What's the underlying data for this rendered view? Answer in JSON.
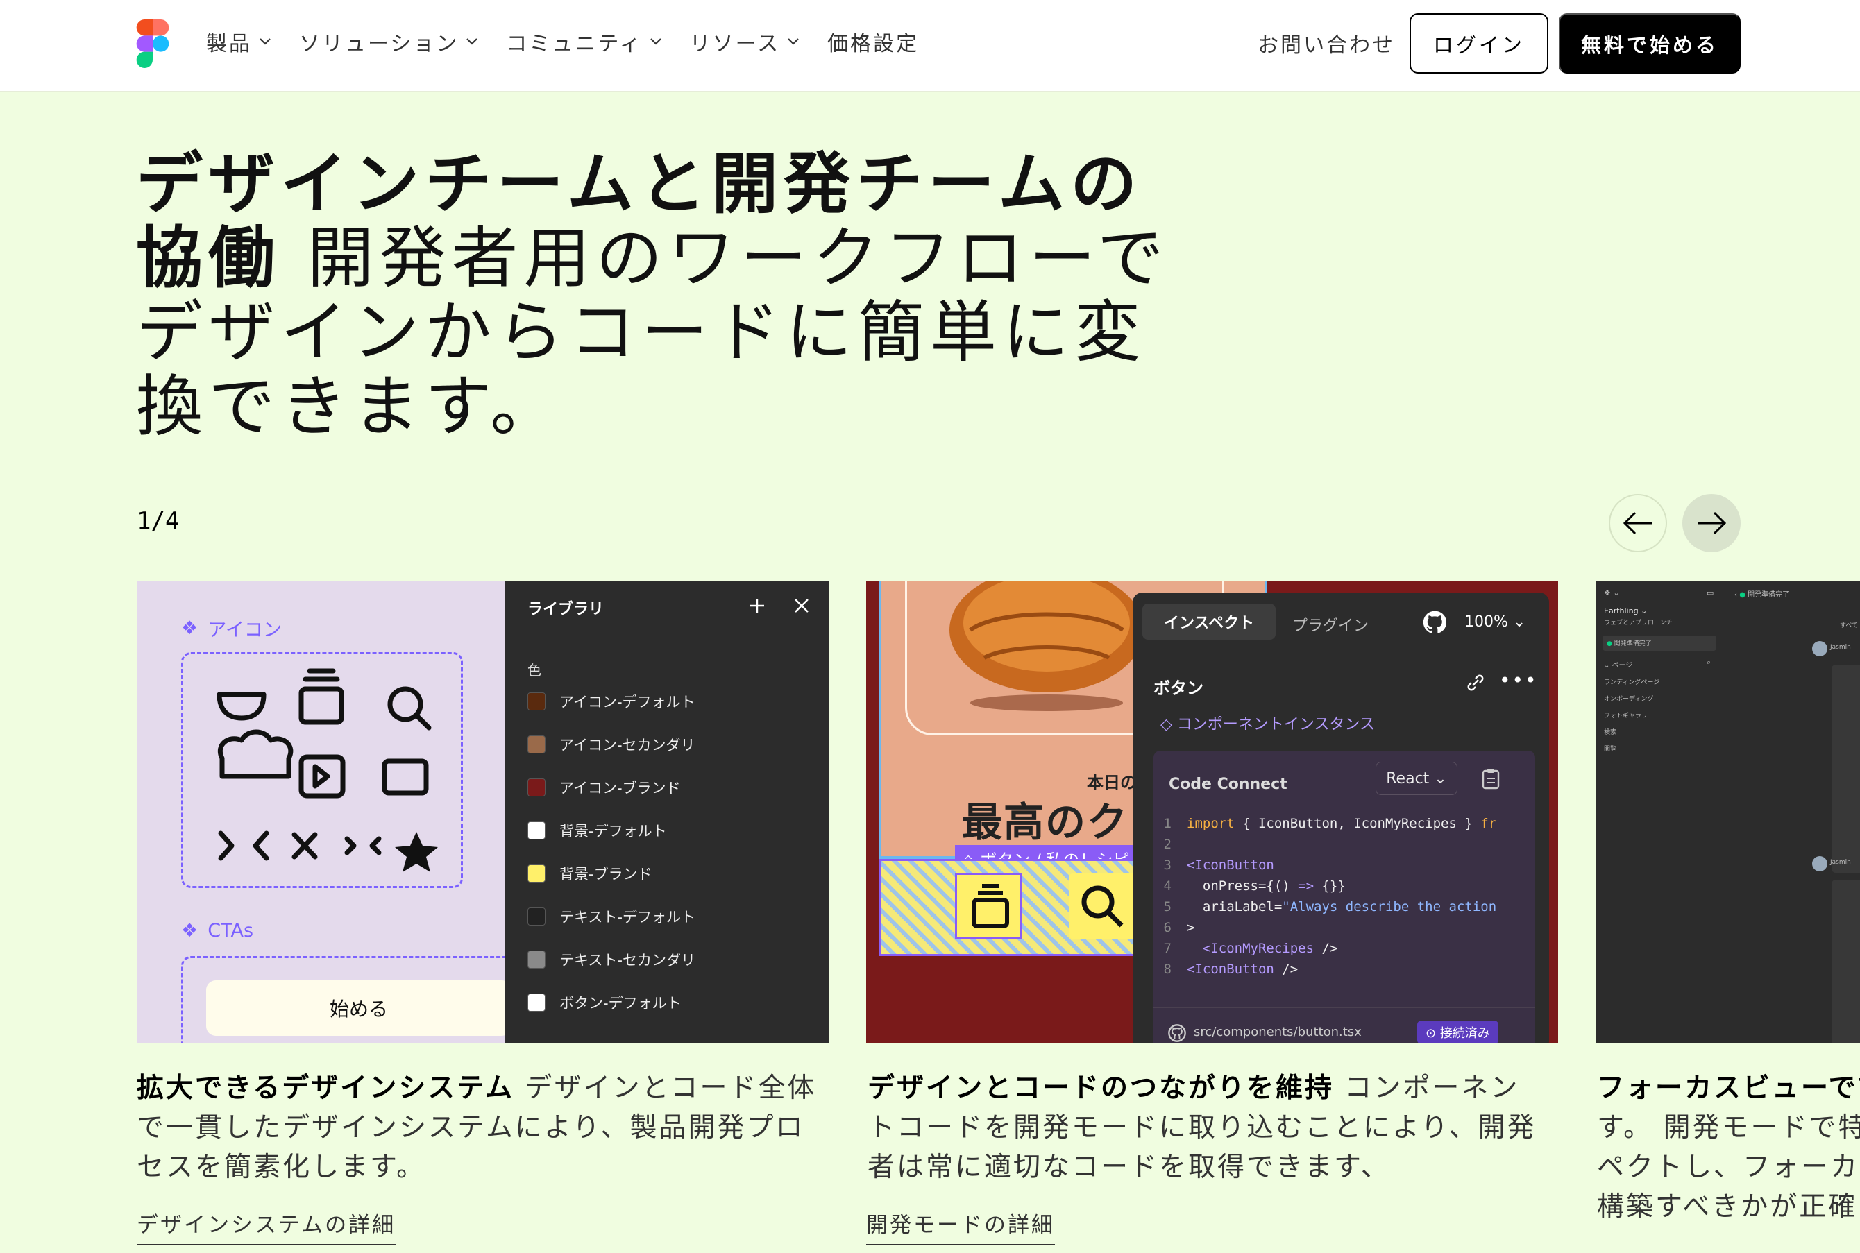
{
  "header": {
    "nav": [
      {
        "label": "製品",
        "has_dropdown": true
      },
      {
        "label": "ソリューション",
        "has_dropdown": true
      },
      {
        "label": "コミュニティ",
        "has_dropdown": true
      },
      {
        "label": "リソース",
        "has_dropdown": true
      },
      {
        "label": "価格設定",
        "has_dropdown": false
      }
    ],
    "contact": "お問い合わせ",
    "login": "ログイン",
    "start": "無料で始める"
  },
  "hero": {
    "bold": "デザインチームと開発チームの協働",
    "rest": " 開発者用のワークフローでデザインからコードに簡単に変換できます。"
  },
  "carousel": {
    "pager": "1/4",
    "prev_icon": "arrow-left-icon",
    "next_icon": "arrow-right-icon"
  },
  "cards": [
    {
      "heading": "拡大できるデザインシステム",
      "body": " デザインとコード全体で一貫したデザインシステムにより、製品開発プロセスを簡素化します。",
      "link": "デザインシステムの詳細",
      "ui": {
        "icons_label": "アイコン",
        "ctas_label": "CTAs",
        "cta_button": "始める",
        "library_title": "ライブラリ",
        "color_section": "色",
        "colors": [
          {
            "name": "アイコン-デフォルト",
            "color": "#5A2A0E"
          },
          {
            "name": "アイコン-セカンダリ",
            "color": "#9A6A4A"
          },
          {
            "name": "アイコン-ブランド",
            "color": "#7A1A1A"
          },
          {
            "name": "背景-デフォルト",
            "color": "#FFFFFF"
          },
          {
            "name": "背景-ブランド",
            "color": "#FFF06A"
          },
          {
            "name": "テキスト-デフォルト",
            "color": "#222222"
          },
          {
            "name": "テキスト-セカンダリ",
            "color": "#8A8A8A"
          },
          {
            "name": "ボタン-デフォルト",
            "color": "#FFFFFF"
          }
        ]
      }
    },
    {
      "heading": "デザインとコードのつながりを維持",
      "body": " コンポーネントコードを開発モードに取り込むことにより、開発者は常に適切なコードを取得できます、",
      "link": "開発モードの詳細",
      "ui": {
        "tab_inspect": "インスペクト",
        "tab_plugin": "プラグイン",
        "zoom": "100%",
        "section_title": "ボタン",
        "component_instance": "コンポーネントインスタンス",
        "code_connect": "Code Connect",
        "framework": "React",
        "file_path": "src/components/button.tsx",
        "status": "接続済み",
        "food_small": "本日の",
        "food_big": "最高のクロ",
        "food_label": "ボタン / 私のレシピ"
      }
    },
    {
      "heading": "フォーカスビューで計",
      "body": "す。 開発モードで特ペクトし、フォーカを構築すべきかが正確",
      "ui": {
        "project": "Earthling",
        "project_sub": "ウェブとアプリローンチ",
        "status_tag": "開発準備完了",
        "pages_label": "ページ",
        "pages": [
          "ランディングページ",
          "オンボーディング",
          "フォトギャラリー",
          "検索",
          "閲覧"
        ],
        "user": "Jasmin",
        "all": "すべて"
      }
    }
  ]
}
